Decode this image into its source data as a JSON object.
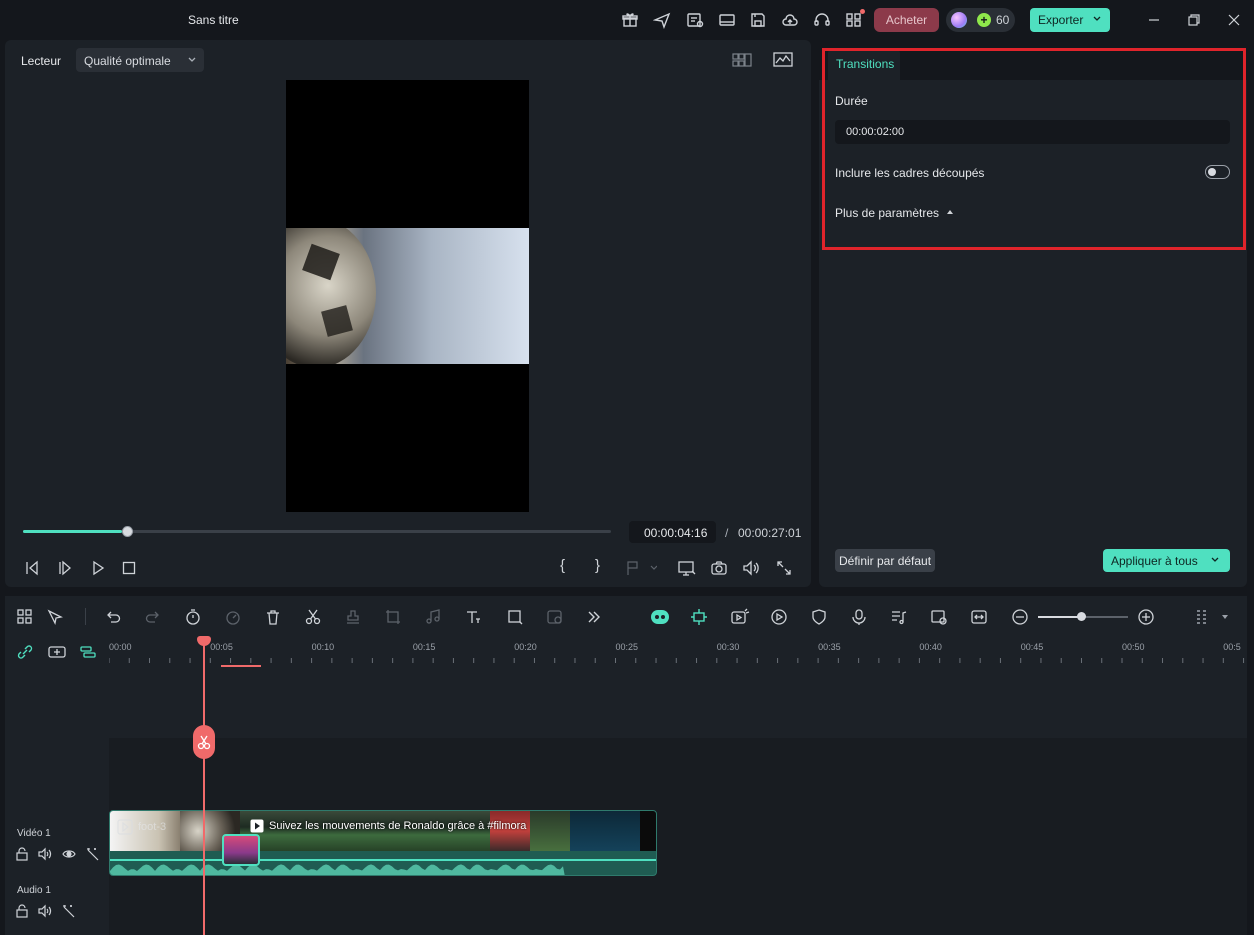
{
  "window": {
    "title": "Sans titre"
  },
  "titlebar": {
    "buy_label": "Acheter",
    "credits": "60",
    "export_label": "Exporter"
  },
  "player": {
    "label": "Lecteur",
    "quality": "Qualité optimale",
    "progress": 0.169,
    "current_time": "00:00:04:16",
    "separator": "/",
    "total_time": "00:00:27:01"
  },
  "properties": {
    "tab": "Transitions",
    "duration_label": "Durée",
    "duration_value": "00:00:02:00",
    "include_label": "Inclure les cadres découpés",
    "include_on": false,
    "more_label": "Plus de paramètres",
    "default_button": "Définir par défaut",
    "apply_button": "Appliquer à tous"
  },
  "timeline": {
    "ruler": [
      "00:00",
      "00:05",
      "00:10",
      "00:15",
      "00:20",
      "00:25",
      "00:30",
      "00:35",
      "00:40",
      "00:45",
      "00:50",
      "00:5"
    ],
    "video_track": "Vidéo 1",
    "audio_track": "Audio 1",
    "clip1_title": "foot-3",
    "clip2_title": "Suivez les mouvements de Ronaldo grâce à #filmora"
  },
  "colors": {
    "accent": "#4fe0c0",
    "highlight_border": "#e0242b",
    "playhead": "#f06a6a",
    "buy": "#8c3a4a"
  }
}
